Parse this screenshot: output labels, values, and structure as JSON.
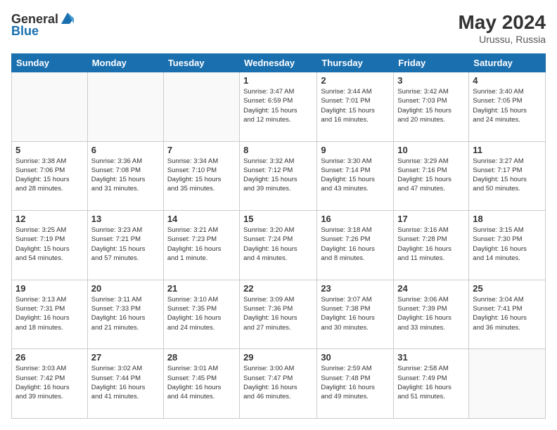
{
  "header": {
    "logo_general": "General",
    "logo_blue": "Blue",
    "month_year": "May 2024",
    "location": "Urussu, Russia"
  },
  "days_of_week": [
    "Sunday",
    "Monday",
    "Tuesday",
    "Wednesday",
    "Thursday",
    "Friday",
    "Saturday"
  ],
  "weeks": [
    [
      {
        "day": "",
        "info": ""
      },
      {
        "day": "",
        "info": ""
      },
      {
        "day": "",
        "info": ""
      },
      {
        "day": "1",
        "info": "Sunrise: 3:47 AM\nSunset: 6:59 PM\nDaylight: 15 hours\nand 12 minutes."
      },
      {
        "day": "2",
        "info": "Sunrise: 3:44 AM\nSunset: 7:01 PM\nDaylight: 15 hours\nand 16 minutes."
      },
      {
        "day": "3",
        "info": "Sunrise: 3:42 AM\nSunset: 7:03 PM\nDaylight: 15 hours\nand 20 minutes."
      },
      {
        "day": "4",
        "info": "Sunrise: 3:40 AM\nSunset: 7:05 PM\nDaylight: 15 hours\nand 24 minutes."
      }
    ],
    [
      {
        "day": "5",
        "info": "Sunrise: 3:38 AM\nSunset: 7:06 PM\nDaylight: 15 hours\nand 28 minutes."
      },
      {
        "day": "6",
        "info": "Sunrise: 3:36 AM\nSunset: 7:08 PM\nDaylight: 15 hours\nand 31 minutes."
      },
      {
        "day": "7",
        "info": "Sunrise: 3:34 AM\nSunset: 7:10 PM\nDaylight: 15 hours\nand 35 minutes."
      },
      {
        "day": "8",
        "info": "Sunrise: 3:32 AM\nSunset: 7:12 PM\nDaylight: 15 hours\nand 39 minutes."
      },
      {
        "day": "9",
        "info": "Sunrise: 3:30 AM\nSunset: 7:14 PM\nDaylight: 15 hours\nand 43 minutes."
      },
      {
        "day": "10",
        "info": "Sunrise: 3:29 AM\nSunset: 7:16 PM\nDaylight: 15 hours\nand 47 minutes."
      },
      {
        "day": "11",
        "info": "Sunrise: 3:27 AM\nSunset: 7:17 PM\nDaylight: 15 hours\nand 50 minutes."
      }
    ],
    [
      {
        "day": "12",
        "info": "Sunrise: 3:25 AM\nSunset: 7:19 PM\nDaylight: 15 hours\nand 54 minutes."
      },
      {
        "day": "13",
        "info": "Sunrise: 3:23 AM\nSunset: 7:21 PM\nDaylight: 15 hours\nand 57 minutes."
      },
      {
        "day": "14",
        "info": "Sunrise: 3:21 AM\nSunset: 7:23 PM\nDaylight: 16 hours\nand 1 minute."
      },
      {
        "day": "15",
        "info": "Sunrise: 3:20 AM\nSunset: 7:24 PM\nDaylight: 16 hours\nand 4 minutes."
      },
      {
        "day": "16",
        "info": "Sunrise: 3:18 AM\nSunset: 7:26 PM\nDaylight: 16 hours\nand 8 minutes."
      },
      {
        "day": "17",
        "info": "Sunrise: 3:16 AM\nSunset: 7:28 PM\nDaylight: 16 hours\nand 11 minutes."
      },
      {
        "day": "18",
        "info": "Sunrise: 3:15 AM\nSunset: 7:30 PM\nDaylight: 16 hours\nand 14 minutes."
      }
    ],
    [
      {
        "day": "19",
        "info": "Sunrise: 3:13 AM\nSunset: 7:31 PM\nDaylight: 16 hours\nand 18 minutes."
      },
      {
        "day": "20",
        "info": "Sunrise: 3:11 AM\nSunset: 7:33 PM\nDaylight: 16 hours\nand 21 minutes."
      },
      {
        "day": "21",
        "info": "Sunrise: 3:10 AM\nSunset: 7:35 PM\nDaylight: 16 hours\nand 24 minutes."
      },
      {
        "day": "22",
        "info": "Sunrise: 3:09 AM\nSunset: 7:36 PM\nDaylight: 16 hours\nand 27 minutes."
      },
      {
        "day": "23",
        "info": "Sunrise: 3:07 AM\nSunset: 7:38 PM\nDaylight: 16 hours\nand 30 minutes."
      },
      {
        "day": "24",
        "info": "Sunrise: 3:06 AM\nSunset: 7:39 PM\nDaylight: 16 hours\nand 33 minutes."
      },
      {
        "day": "25",
        "info": "Sunrise: 3:04 AM\nSunset: 7:41 PM\nDaylight: 16 hours\nand 36 minutes."
      }
    ],
    [
      {
        "day": "26",
        "info": "Sunrise: 3:03 AM\nSunset: 7:42 PM\nDaylight: 16 hours\nand 39 minutes."
      },
      {
        "day": "27",
        "info": "Sunrise: 3:02 AM\nSunset: 7:44 PM\nDaylight: 16 hours\nand 41 minutes."
      },
      {
        "day": "28",
        "info": "Sunrise: 3:01 AM\nSunset: 7:45 PM\nDaylight: 16 hours\nand 44 minutes."
      },
      {
        "day": "29",
        "info": "Sunrise: 3:00 AM\nSunset: 7:47 PM\nDaylight: 16 hours\nand 46 minutes."
      },
      {
        "day": "30",
        "info": "Sunrise: 2:59 AM\nSunset: 7:48 PM\nDaylight: 16 hours\nand 49 minutes."
      },
      {
        "day": "31",
        "info": "Sunrise: 2:58 AM\nSunset: 7:49 PM\nDaylight: 16 hours\nand 51 minutes."
      },
      {
        "day": "",
        "info": ""
      }
    ]
  ]
}
